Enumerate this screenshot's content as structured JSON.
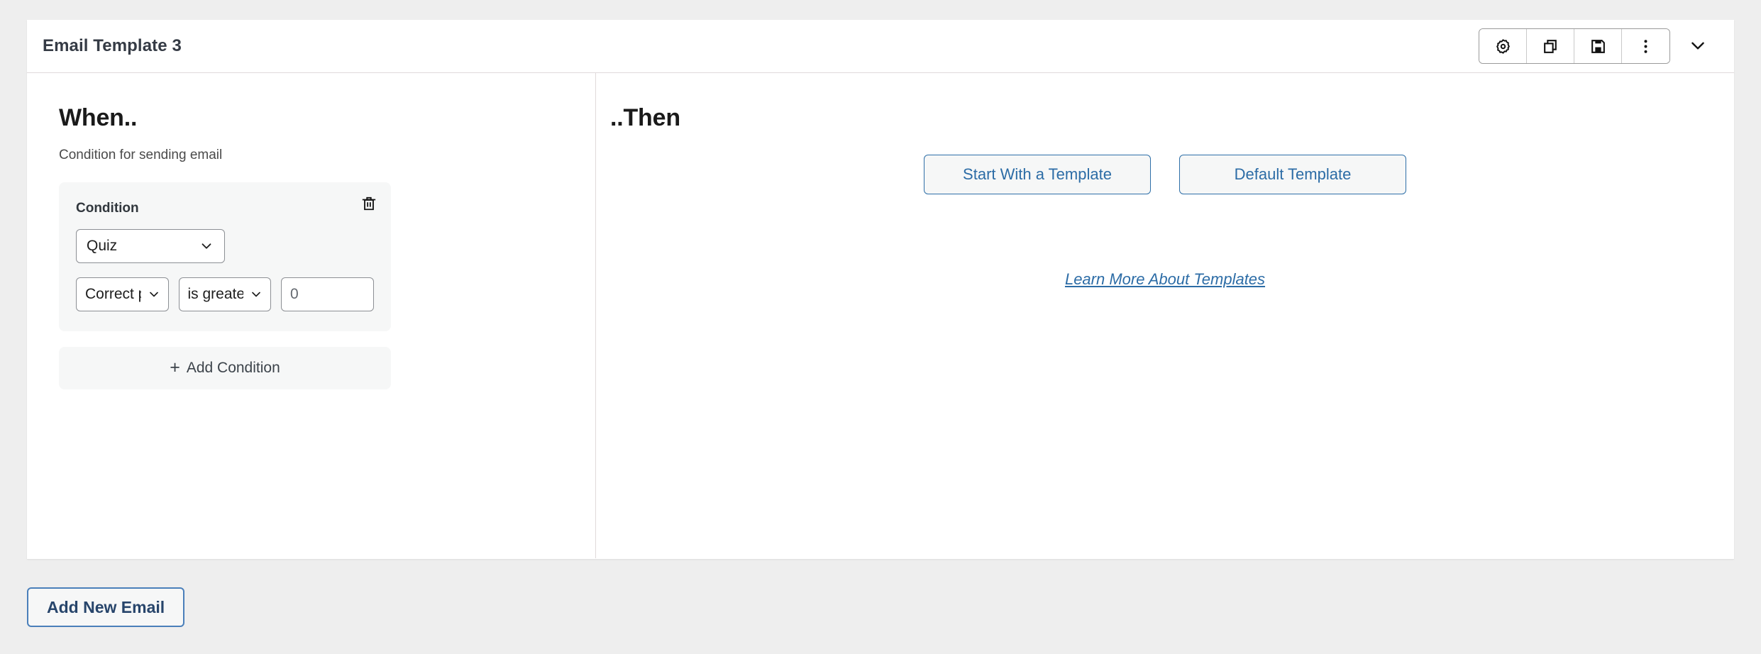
{
  "header": {
    "title": "Email Template 3",
    "actions": [
      {
        "name": "settings-button",
        "icon": "gear-icon"
      },
      {
        "name": "duplicate-button",
        "icon": "copy-icon"
      },
      {
        "name": "save-button",
        "icon": "floppy-disk-icon"
      },
      {
        "name": "more-options-button",
        "icon": "dots-vertical-icon"
      }
    ],
    "collapse": {
      "name": "collapse-button",
      "icon": "chevron-down-icon"
    }
  },
  "when_pane": {
    "heading": "When..",
    "subtitle": "Condition for sending email",
    "condition": {
      "label": "Condition",
      "delete_icon": "trash-icon",
      "source_select": {
        "value": "Quiz",
        "caret": "chevron-down-icon"
      },
      "field_select": {
        "value": "Correct pe",
        "caret": "chevron-down-icon"
      },
      "operator_select": {
        "value": "is greater t",
        "caret": "chevron-down-icon"
      },
      "value_input": {
        "value": "",
        "placeholder": "0"
      }
    },
    "add_condition_label": "Add Condition",
    "add_condition_icon": "plus-icon"
  },
  "then_pane": {
    "heading": "..Then",
    "start_template_label": "Start With a Template",
    "default_template_label": "Default Template",
    "learn_more_label": "Learn More About Templates"
  },
  "footer": {
    "add_new_email_label": "Add New Email"
  },
  "colors": {
    "page_background": "#eeeeee",
    "card_background": "#ffffff",
    "panel_background": "#f6f7f7",
    "border": "#e0dadb",
    "control_border": "#8c8f94",
    "accent_blue": "#2c6ca6",
    "footer_border_blue": "#4a7fba",
    "footer_text": "#27456b",
    "title_text": "#353b45",
    "heading_text": "#1a1a1a"
  }
}
